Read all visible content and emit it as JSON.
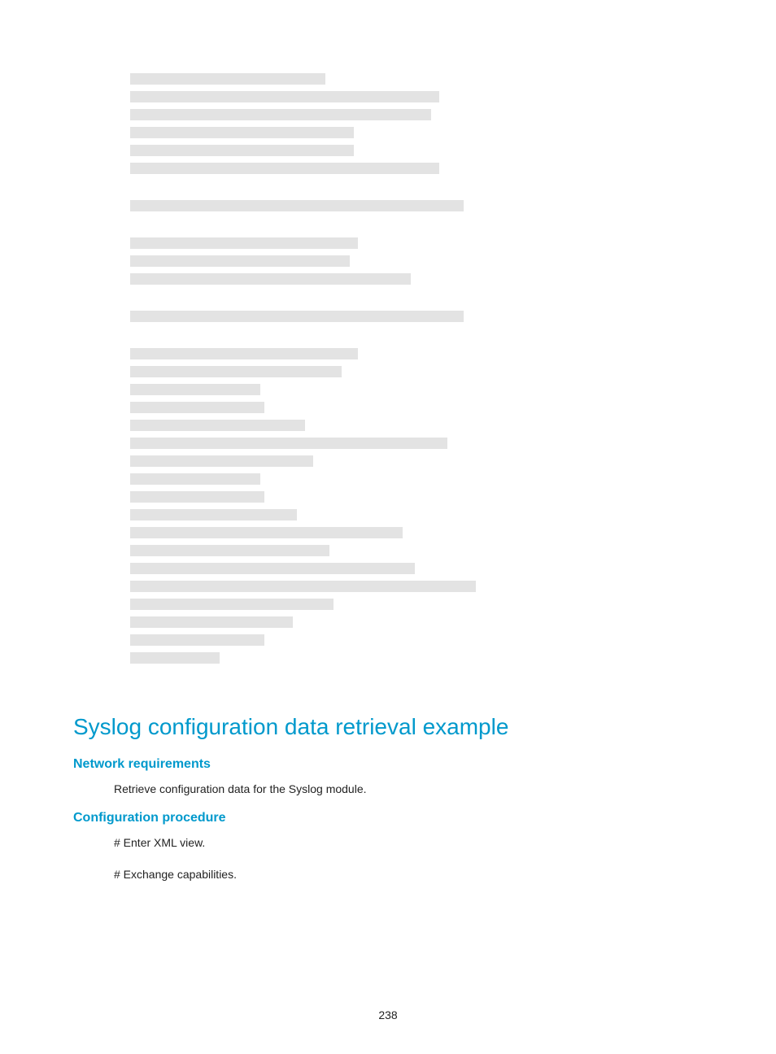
{
  "redacted_bars": [
    240,
    380,
    370,
    275,
    275,
    380,
    0,
    410,
    0,
    280,
    270,
    345,
    0,
    410,
    0,
    280,
    260,
    160,
    165,
    215,
    390,
    225,
    160,
    165,
    205,
    335,
    245,
    350,
    425,
    250,
    200,
    165,
    110
  ],
  "section": {
    "title": "Syslog configuration data retrieval example",
    "network_req_heading": "Network requirements",
    "network_req_body": "Retrieve configuration data for the Syslog module.",
    "config_proc_heading": "Configuration procedure",
    "config_step_1": "# Enter XML view.",
    "config_step_2": "# Exchange capabilities."
  },
  "page_number": "238"
}
